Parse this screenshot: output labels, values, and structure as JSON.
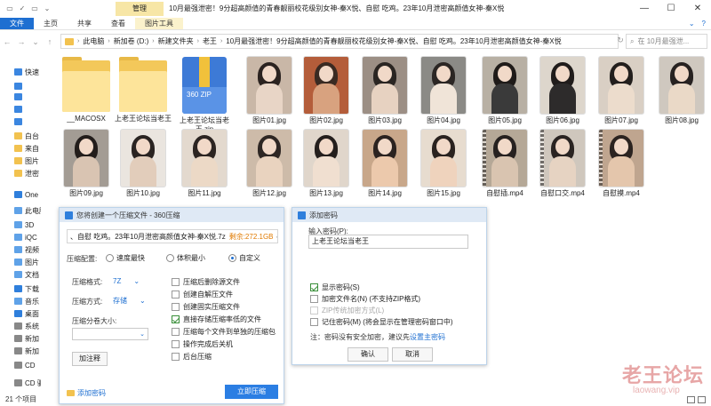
{
  "window": {
    "context_tab": "管理",
    "title": "10月最强泄密！9分超高颜值的青春靓丽校花级别女神-秦X悦、自慰 吃鸡。23年10月泄密高颜值女神-秦X悦",
    "controls": [
      "—",
      "☐",
      "✕"
    ]
  },
  "ribbon": {
    "tabs": [
      "文件",
      "主页",
      "共享",
      "查看",
      "图片工具"
    ],
    "right_icons": [
      "⌄",
      "?"
    ]
  },
  "address": {
    "nav": [
      "←",
      "→",
      "⌄",
      "↑"
    ],
    "crumbs": [
      "此电脑",
      "新加卷 (D:)",
      "新建文件夹",
      "老王",
      "10月最强泄密！9分超高颜值的青春靓丽校花级别女神-秦X悦、自慰 吃鸡。23年10月泄密高颜值女神-秦X悦"
    ],
    "refresh": "↻",
    "search_placeholder": "在 10月最强泄..."
  },
  "sidebar": {
    "items": [
      {
        "label": "快速",
        "color": "#3b86e0"
      },
      {
        "label": "",
        "color": "#3b86e0"
      },
      {
        "label": "",
        "color": "#3b86e0"
      },
      {
        "label": "",
        "color": "#3b86e0"
      },
      {
        "label": "",
        "color": "#3b86e0"
      },
      {
        "label": "白台",
        "color": "#f2c24f"
      },
      {
        "label": "来自",
        "color": "#f2c24f"
      },
      {
        "label": "图片",
        "color": "#f2c24f"
      },
      {
        "label": "泄密",
        "color": "#f2c24f"
      },
      {
        "label": "One",
        "color": "#2f7fdc"
      },
      {
        "label": "此电脑",
        "color": "#5fa2e8"
      },
      {
        "label": "3D",
        "color": "#5fa2e8"
      },
      {
        "label": "iQC",
        "color": "#5fa2e8"
      },
      {
        "label": "视频",
        "color": "#5fa2e8"
      },
      {
        "label": "图片",
        "color": "#5fa2e8"
      },
      {
        "label": "文档",
        "color": "#5fa2e8"
      },
      {
        "label": "下载",
        "color": "#2f7fdc"
      },
      {
        "label": "音乐",
        "color": "#5fa2e8"
      },
      {
        "label": "桌面",
        "color": "#2f7fdc"
      },
      {
        "label": "系统",
        "color": "#888888"
      },
      {
        "label": "新加",
        "color": "#888888"
      },
      {
        "label": "新加",
        "color": "#888888"
      },
      {
        "label": "CD",
        "color": "#888888"
      },
      {
        "label": "CD 驱",
        "color": "#888888"
      }
    ]
  },
  "files": [
    {
      "name": "__MACOSX",
      "kind": "folder"
    },
    {
      "name": "上老王论坛当老王",
      "kind": "folder"
    },
    {
      "name": "上老王论坛当老王.zip",
      "kind": "zip",
      "zip_label": "360 ZIP"
    },
    {
      "name": "图片01.jpg",
      "kind": "photo",
      "bg": "#c9b7a7",
      "hair": "#2b2320",
      "body": "#e8d5c6"
    },
    {
      "name": "图片02.jpg",
      "kind": "photo",
      "bg": "#b45d3a",
      "hair": "#3a2a22",
      "body": "#d8a27f"
    },
    {
      "name": "图片03.jpg",
      "kind": "photo",
      "bg": "#9c8f85",
      "hair": "#2a2522",
      "body": "#e7d2c1"
    },
    {
      "name": "图片04.jpg",
      "kind": "photo",
      "bg": "#8b8a86",
      "hair": "#2b2624",
      "body": "#f0e4d8"
    },
    {
      "name": "图片05.jpg",
      "kind": "photo",
      "bg": "#b8b0a4",
      "hair": "#1f1b19",
      "body": "#3a3a3a"
    },
    {
      "name": "图片06.jpg",
      "kind": "photo",
      "bg": "#ddd6cc",
      "hair": "#201c1b",
      "body": "#2d2b2b"
    },
    {
      "name": "图片07.jpg",
      "kind": "photo",
      "bg": "#d9cfc4",
      "hair": "#231f1d",
      "body": "#ecdccc"
    },
    {
      "name": "图片08.jpg",
      "kind": "photo",
      "bg": "#cfc8bf",
      "hair": "#272221",
      "body": "#ead9c7"
    },
    {
      "name": "图片09.jpg",
      "kind": "photo",
      "bg": "#a39c94",
      "hair": "#221d1b",
      "body": "#d9c4b2"
    },
    {
      "name": "图片10.jpg",
      "kind": "photo",
      "bg": "#eae5df",
      "hair": "#2a2422",
      "body": "#e2cdbb"
    },
    {
      "name": "图片11.jpg",
      "kind": "photo",
      "bg": "#e3d9ce",
      "hair": "#2c2522",
      "body": "#ecd9c6"
    },
    {
      "name": "图片12.jpg",
      "kind": "photo",
      "bg": "#cdbba9",
      "hair": "#2e2724",
      "body": "#e9d3bf"
    },
    {
      "name": "图片13.jpg",
      "kind": "photo",
      "bg": "#e0d6cb",
      "hair": "#241f1d",
      "body": "#f0dfd0"
    },
    {
      "name": "图片14.jpg",
      "kind": "photo",
      "bg": "#c8a78a",
      "hair": "#2b2320",
      "body": "#ecc9ac"
    },
    {
      "name": "图片15.jpg",
      "kind": "photo",
      "bg": "#e7dccf",
      "hair": "#2a2320",
      "body": "#efd3bd"
    },
    {
      "name": "自慰插.mp4",
      "kind": "video",
      "bg": "#b5a897",
      "hair": "#262120",
      "body": "#d9c4b0"
    },
    {
      "name": "自慰口交.mp4",
      "kind": "video",
      "bg": "#cfc7bd",
      "hair": "#2a2422",
      "body": "#e6d3c2"
    },
    {
      "name": "自慰摸.mp4",
      "kind": "video",
      "bg": "#bfa58f",
      "hair": "#2b2320",
      "body": "#e4c6ac"
    }
  ],
  "dialog_360": {
    "title": "您将创建一个压缩文件 - 360压缩",
    "path": "、自慰 吃鸡。23年10月泄密高颜值女神-秦X悦.7z",
    "remaining": "剩余:272.1GB",
    "config_label": "压缩配置:",
    "radios": [
      {
        "label": "速度最快",
        "on": false
      },
      {
        "label": "体积最小",
        "on": false
      },
      {
        "label": "自定义",
        "on": true
      }
    ],
    "format_label": "压缩格式:",
    "format_value": "7Z",
    "method_label": "压缩方式:",
    "method_value": "存储",
    "split_label": "压缩分卷大小:",
    "comment_button": "加注释",
    "checkboxes": [
      {
        "label": "压缩后删除源文件",
        "on": false
      },
      {
        "label": "创建自解压文件",
        "on": false
      },
      {
        "label": "创建固实压缩文件",
        "on": false
      },
      {
        "label": "直接存储压缩率低的文件",
        "on": true
      },
      {
        "label": "压缩每个文件到单独的压缩包",
        "on": false
      },
      {
        "label": "操作完成后关机",
        "on": false
      },
      {
        "label": "后台压缩",
        "on": false
      }
    ],
    "add_password_link": "添加密码",
    "compress_button": "立即压缩"
  },
  "dialog_pw": {
    "title": "添加密码",
    "input_label": "输入密码(P):",
    "password_value": "上老王论坛当老王",
    "show_pw": "显示密码(S)",
    "encrypt_names": "加密文件名(N) (不支持ZIP格式)",
    "zip_legacy": "ZIP传统加密方式(L)",
    "remember": "记住密码(M) (将会显示在管理密码窗口中)",
    "note_prefix": "注：密码没有安全加密，建议先",
    "note_link": "设置主密码",
    "ok": "确认",
    "cancel": "取消"
  },
  "status": {
    "count": "21 个项目"
  },
  "watermark": {
    "cn": "老王论坛",
    "en": "laowang.vip"
  }
}
